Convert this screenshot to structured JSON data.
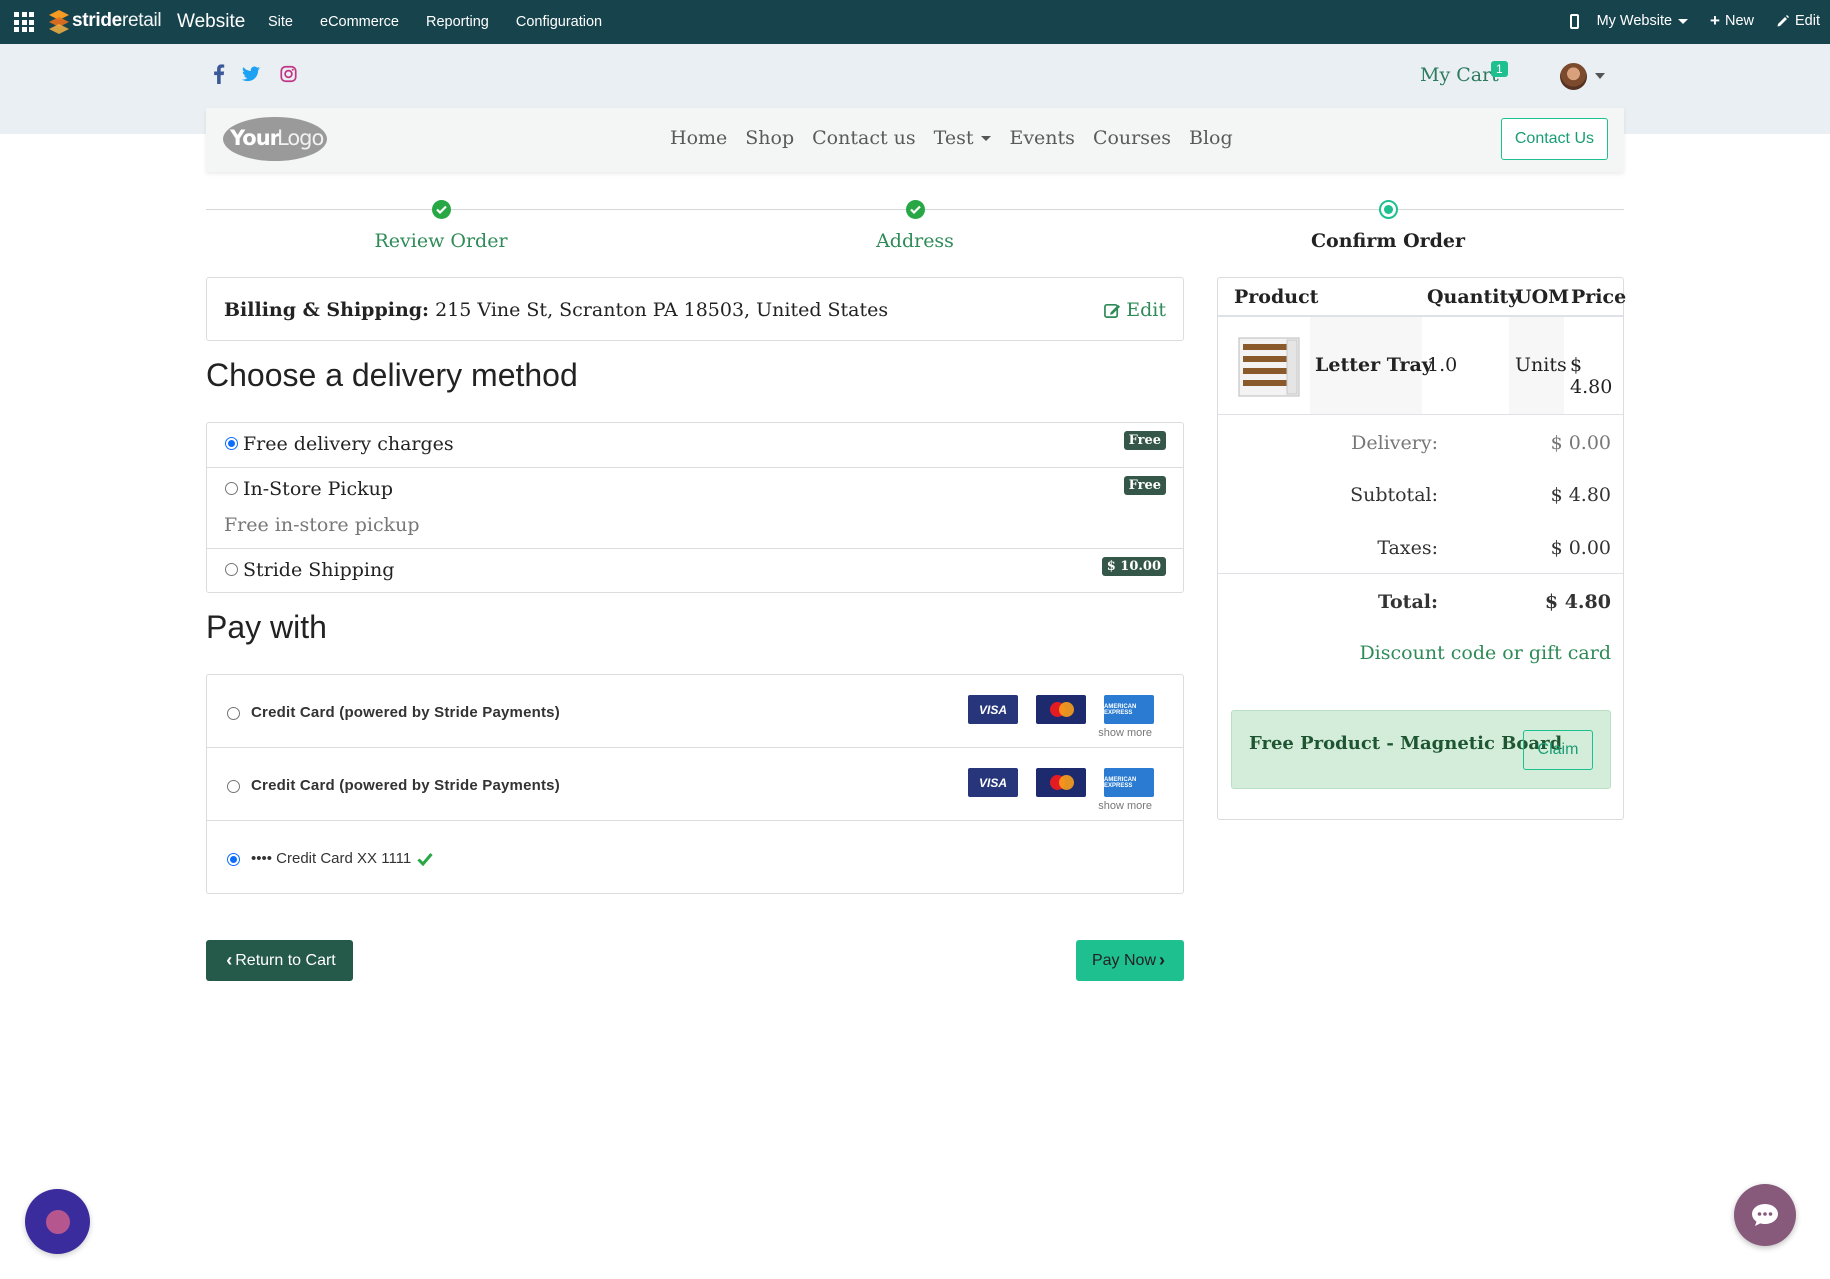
{
  "admin_bar": {
    "brand_bold": "stride",
    "brand_light": "retail",
    "app_name": "Website",
    "menu": [
      "Site",
      "eCommerce",
      "Reporting",
      "Configuration"
    ],
    "website_selector": "My Website",
    "new_label": "New",
    "edit_label": "Edit",
    "bg_color": "#17434d"
  },
  "header": {
    "social_icons": [
      "facebook-icon",
      "twitter-icon",
      "instagram-icon"
    ],
    "cart_label": "My Cart",
    "cart_count": "1",
    "logo_text": "YourLogo",
    "nav": [
      "Home",
      "Shop",
      "Contact us",
      "Test",
      "Events",
      "Courses",
      "Blog"
    ],
    "contact_button": "Contact Us"
  },
  "steps": [
    {
      "label": "Review Order",
      "state": "done"
    },
    {
      "label": "Address",
      "state": "done"
    },
    {
      "label": "Confirm Order",
      "state": "current"
    }
  ],
  "billing": {
    "label": "Billing & Shipping:",
    "address": "215 Vine St, Scranton PA 18503, United States",
    "edit_label": "Edit"
  },
  "delivery": {
    "heading": "Choose a delivery method",
    "methods": [
      {
        "label": "Free delivery charges",
        "price": "Free",
        "selected": true,
        "description": ""
      },
      {
        "label": "In-Store Pickup",
        "price": "Free",
        "selected": false,
        "description": "Free in-store pickup"
      },
      {
        "label": "Stride Shipping",
        "price": "$ 10.00",
        "selected": false,
        "description": ""
      }
    ]
  },
  "payment": {
    "heading": "Pay with",
    "options": [
      {
        "label": "Credit Card (powered by Stride Payments)",
        "show_more": "show more",
        "selected": false
      },
      {
        "label": "Credit Card (powered by Stride Payments)",
        "show_more": "show more",
        "selected": false
      }
    ],
    "card_brands": [
      "VISA",
      "MasterCard",
      "AMERICAN EXPRESS"
    ],
    "saved_card": {
      "label": "•••• Credit Card XX 1111",
      "selected": true
    }
  },
  "buttons": {
    "return": "Return to Cart",
    "pay": "Pay Now"
  },
  "summary": {
    "headers": {
      "product": "Product",
      "quantity": "Quantity",
      "uom": "UOM",
      "price": "Price"
    },
    "item": {
      "name": "Letter Tray",
      "quantity": "1.0",
      "uom": "Units",
      "price": "$ 4.80"
    },
    "delivery_label": "Delivery:",
    "delivery_value": "$ 0.00",
    "subtotal_label": "Subtotal:",
    "subtotal_value": "$ 4.80",
    "taxes_label": "Taxes:",
    "taxes_value": "$ 0.00",
    "total_label": "Total:",
    "total_value": "$ 4.80",
    "discount_link": "Discount code or gift card",
    "promo_text": "Free Product - Magnetic Board",
    "claim_label": "Claim"
  },
  "colors": {
    "accent": "#1ec08f",
    "success": "#28a745",
    "badge": "#35574a",
    "return_button": "#25594a"
  }
}
